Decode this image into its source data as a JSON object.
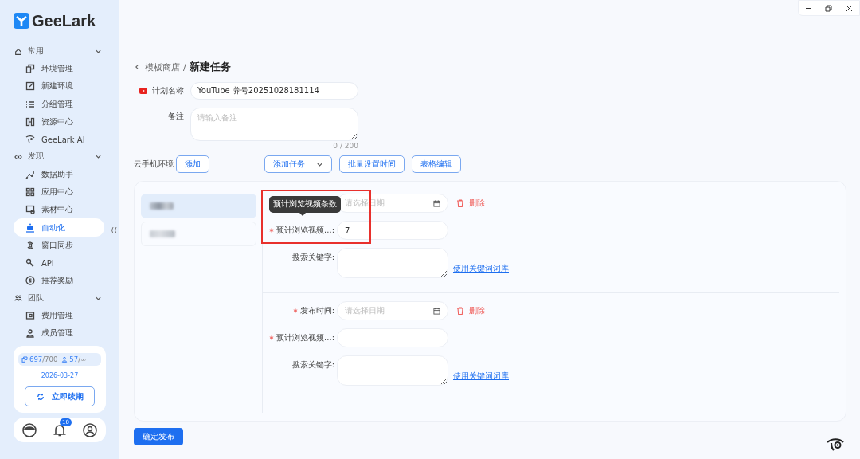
{
  "app": {
    "name": "GeeLark"
  },
  "sidebar": {
    "sections": [
      {
        "label": "常用",
        "expanded": true,
        "items": [
          {
            "label": "环境管理",
            "selected": false
          },
          {
            "label": "新建环境",
            "selected": false
          },
          {
            "label": "分组管理",
            "selected": false
          },
          {
            "label": "资源中心",
            "selected": false
          },
          {
            "label": "GeeLark AI",
            "selected": false
          }
        ]
      },
      {
        "label": "发现",
        "expanded": true,
        "items": [
          {
            "label": "数据助手",
            "selected": false
          },
          {
            "label": "应用中心",
            "selected": false
          },
          {
            "label": "素材中心",
            "selected": false
          },
          {
            "label": "自动化",
            "selected": true
          },
          {
            "label": "窗口同步",
            "selected": false
          },
          {
            "label": "API",
            "selected": false
          },
          {
            "label": "推荐奖励",
            "selected": false
          }
        ]
      },
      {
        "label": "团队",
        "expanded": true,
        "items": [
          {
            "label": "费用管理",
            "selected": false
          },
          {
            "label": "成员管理",
            "selected": false
          }
        ]
      }
    ]
  },
  "account": {
    "devices": "697",
    "devices_max": "/700",
    "members": "57",
    "members_max": "/∞",
    "expiry": "2026-03-27",
    "renew_button": "立即续期"
  },
  "footer": {
    "notification_count": "10"
  },
  "breadcrumb": {
    "parent": "模板商店",
    "separator": "/",
    "current": "新建任务"
  },
  "form": {
    "name_label": "计划名称",
    "name_value": "YouTube 养号20251028181114",
    "note_label": "备注",
    "note_placeholder": "请输入备注",
    "note_counter": "0 / 200"
  },
  "environment": {
    "label": "云手机环境",
    "add_button": "添加",
    "devices": [
      {
        "selected": true
      },
      {
        "selected": false
      }
    ]
  },
  "toolbar": [
    {
      "label": "添加任务",
      "kind": "dropdown"
    },
    {
      "label": "批量设置时间",
      "kind": "button"
    },
    {
      "label": "表格编辑",
      "kind": "button"
    }
  ],
  "tasks": [
    {
      "highlighted": true,
      "tooltip": "预计浏览视频条数",
      "delete": "删除",
      "fields": [
        {
          "kind": "date",
          "placeholder": "请选择日期"
        },
        {
          "kind": "text",
          "label": "预计浏览视频...:",
          "required": true,
          "value": "7"
        },
        {
          "kind": "textarea",
          "label": "搜索关键字:",
          "required": false,
          "link": "使用关键词词库"
        }
      ]
    },
    {
      "highlighted": false,
      "delete": "删除",
      "fields": [
        {
          "kind": "date",
          "label": "发布时间:",
          "required": true,
          "placeholder": "请选择日期"
        },
        {
          "kind": "text",
          "label": "预计浏览视频...:",
          "required": true
        },
        {
          "kind": "textarea",
          "label": "搜索关键字:",
          "required": false,
          "link": "使用关键词词库"
        }
      ]
    }
  ],
  "submit_button": "确定发布"
}
